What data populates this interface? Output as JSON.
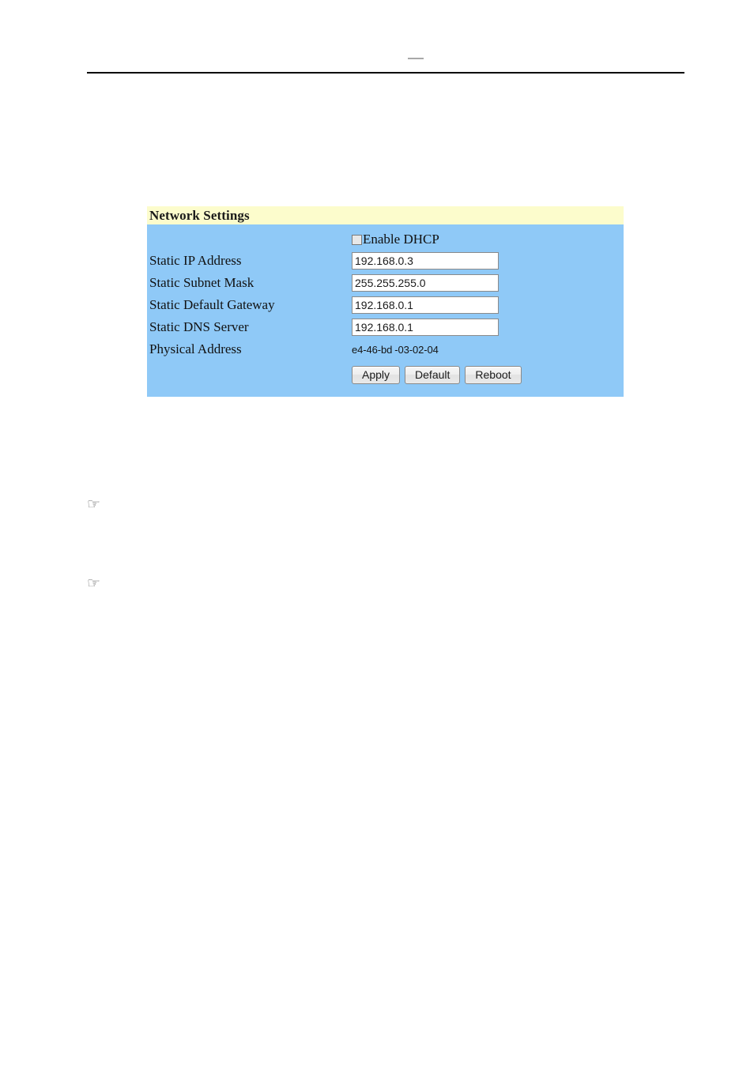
{
  "page": {
    "header_mark": "—",
    "hand_bullet_glyph": "☞"
  },
  "panel": {
    "title": "Network Settings",
    "title_bg": "#fcfccc",
    "body_bg": "#8fc9f7",
    "dhcp": {
      "label": "Enable DHCP",
      "checked": false
    },
    "fields": [
      {
        "label": "Static IP Address",
        "value": "192.168.0.3"
      },
      {
        "label": "Static Subnet Mask",
        "value": "255.255.255.0"
      },
      {
        "label": "Static Default Gateway",
        "value": "192.168.0.1"
      },
      {
        "label": "Static DNS Server",
        "value": "192.168.0.1"
      }
    ],
    "physical_address": {
      "label": "Physical Address",
      "value_part1": "e4-46-bd",
      "value_part2": "03-02-04"
    },
    "buttons": [
      {
        "label": "Apply"
      },
      {
        "label": "Default"
      },
      {
        "label": "Reboot"
      }
    ]
  }
}
